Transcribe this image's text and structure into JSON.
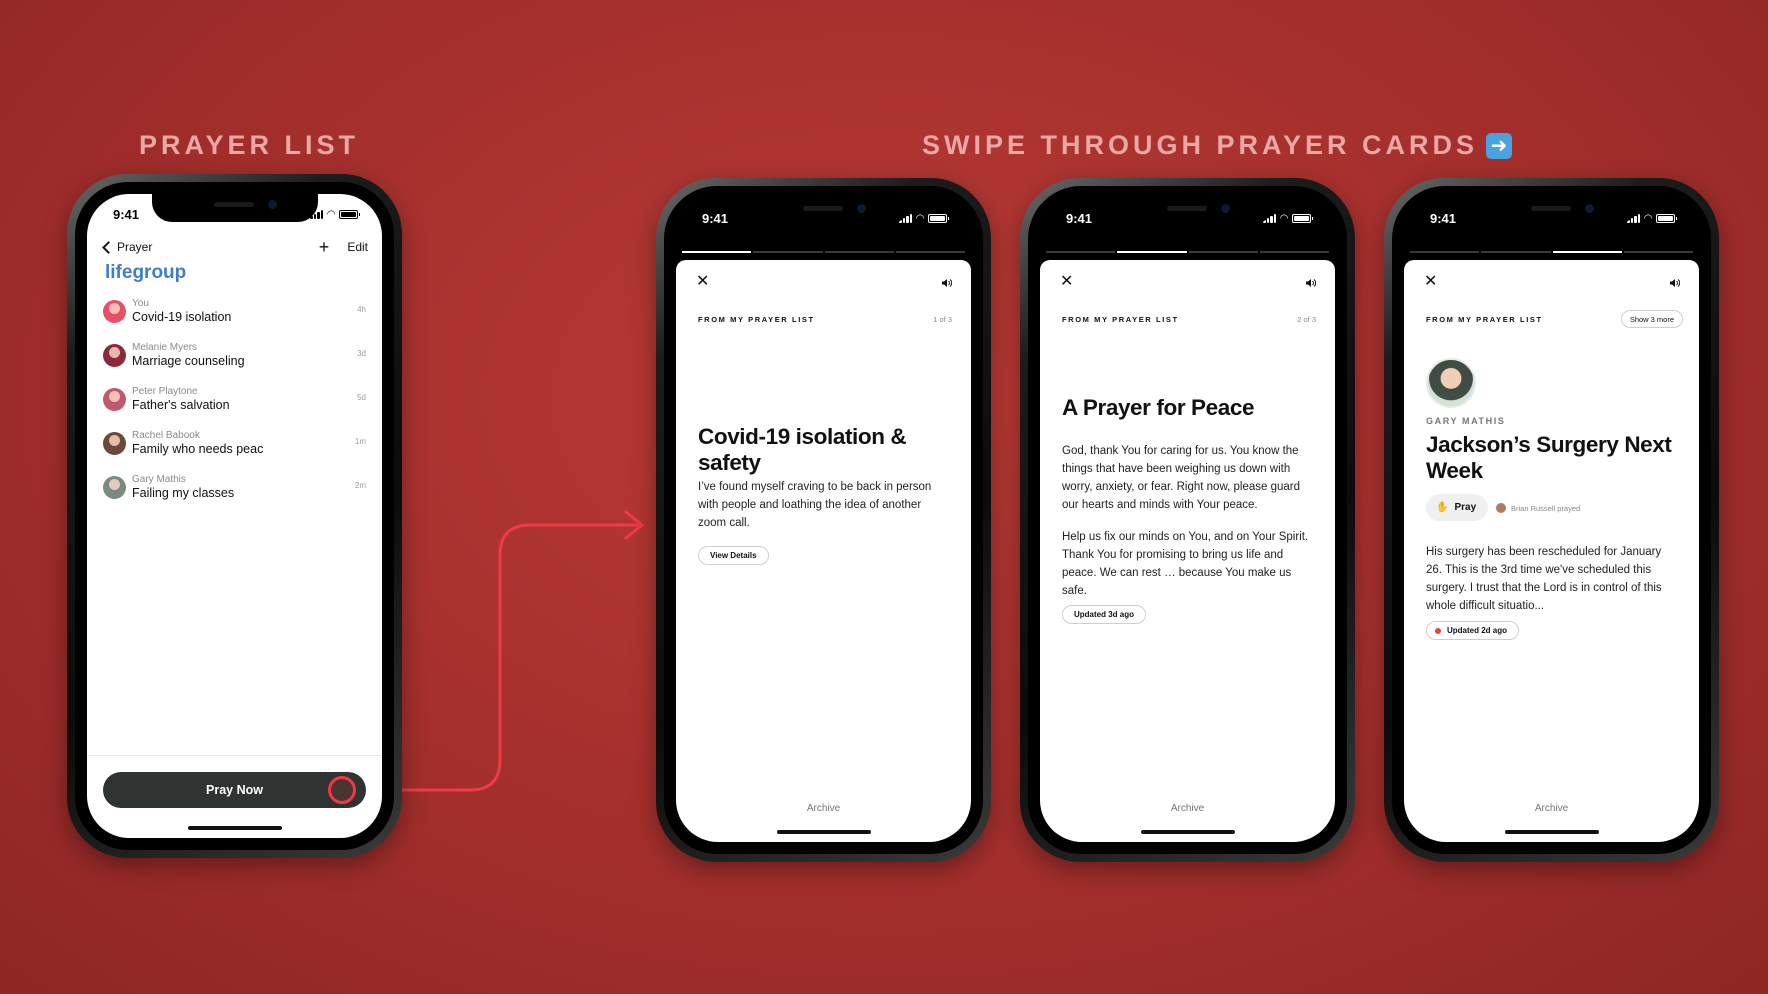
{
  "headings": {
    "prayer_list": "PRAYER LIST",
    "swipe": "SWIPE THROUGH PRAYER CARDS",
    "swipe_arrow_icon": "right-arrow-emoji"
  },
  "colors": {
    "background": "#a8312e",
    "accent_blue": "#3f7ec6",
    "connector_red": "#ef3b46",
    "button_dark": "#2f3331"
  },
  "list_screen": {
    "time": "9:41",
    "back_label": "Prayer",
    "add_icon": "+",
    "edit_label": "Edit",
    "group_title": "lifegroup",
    "items": [
      {
        "name": "You",
        "title": "Covid-19 isolation",
        "time": "4h",
        "avatar_color": "#e8506a"
      },
      {
        "name": "Melanie Myers",
        "title": "Marriage counseling",
        "time": "3d",
        "avatar_color": "#8c2a3a"
      },
      {
        "name": "Peter Playtone",
        "title": "Father's salvation",
        "time": "5d",
        "avatar_color": "#c05a6a"
      },
      {
        "name": "Rachel Babook",
        "title": "Family who needs peac",
        "time": "1m",
        "avatar_color": "#6a4a3a"
      },
      {
        "name": "Gary Mathis",
        "title": "Failing my classes",
        "time": "2m",
        "avatar_color": "#7a8a80"
      }
    ],
    "pray_now_label": "Pray Now"
  },
  "cards": [
    {
      "time": "9:41",
      "label": "FROM MY PRAYER LIST",
      "count": "1 of 3",
      "title": "Covid-19 isolation & safety",
      "body": "I’ve found myself craving to be back in person with people and loathing the idea of another zoom call.",
      "pill": "View Details",
      "archive": "Archive"
    },
    {
      "time": "9:41",
      "label": "FROM MY PRAYER LIST",
      "count": "2 of 3",
      "title": "A Prayer for Peace",
      "body_1": "God, thank You for caring for us. You know the things that have been weighing us down with worry, anxiety, or fear. Right now, please guard our hearts and minds with Your peace.",
      "body_2": "Help us fix our minds on You, and on Your Spirit. Thank You for promising to bring us life and peace. We can rest … because You make us safe.",
      "pill": "Updated 3d ago",
      "archive": "Archive"
    },
    {
      "time": "9:41",
      "label": "FROM MY PRAYER LIST",
      "show_more": "Show 3 more",
      "person": "GARY MATHIS",
      "title": "Jackson’s Surgery Next Week",
      "pray_label": "Pray",
      "prayed_by": "Brian Russell prayed",
      "body": "His surgery has been rescheduled for January 26. This is the 3rd time we've scheduled this surgery. I trust that the Lord is in control of this whole difficult situatio...",
      "pill": "Updated 2d ago",
      "archive": "Archive"
    }
  ]
}
